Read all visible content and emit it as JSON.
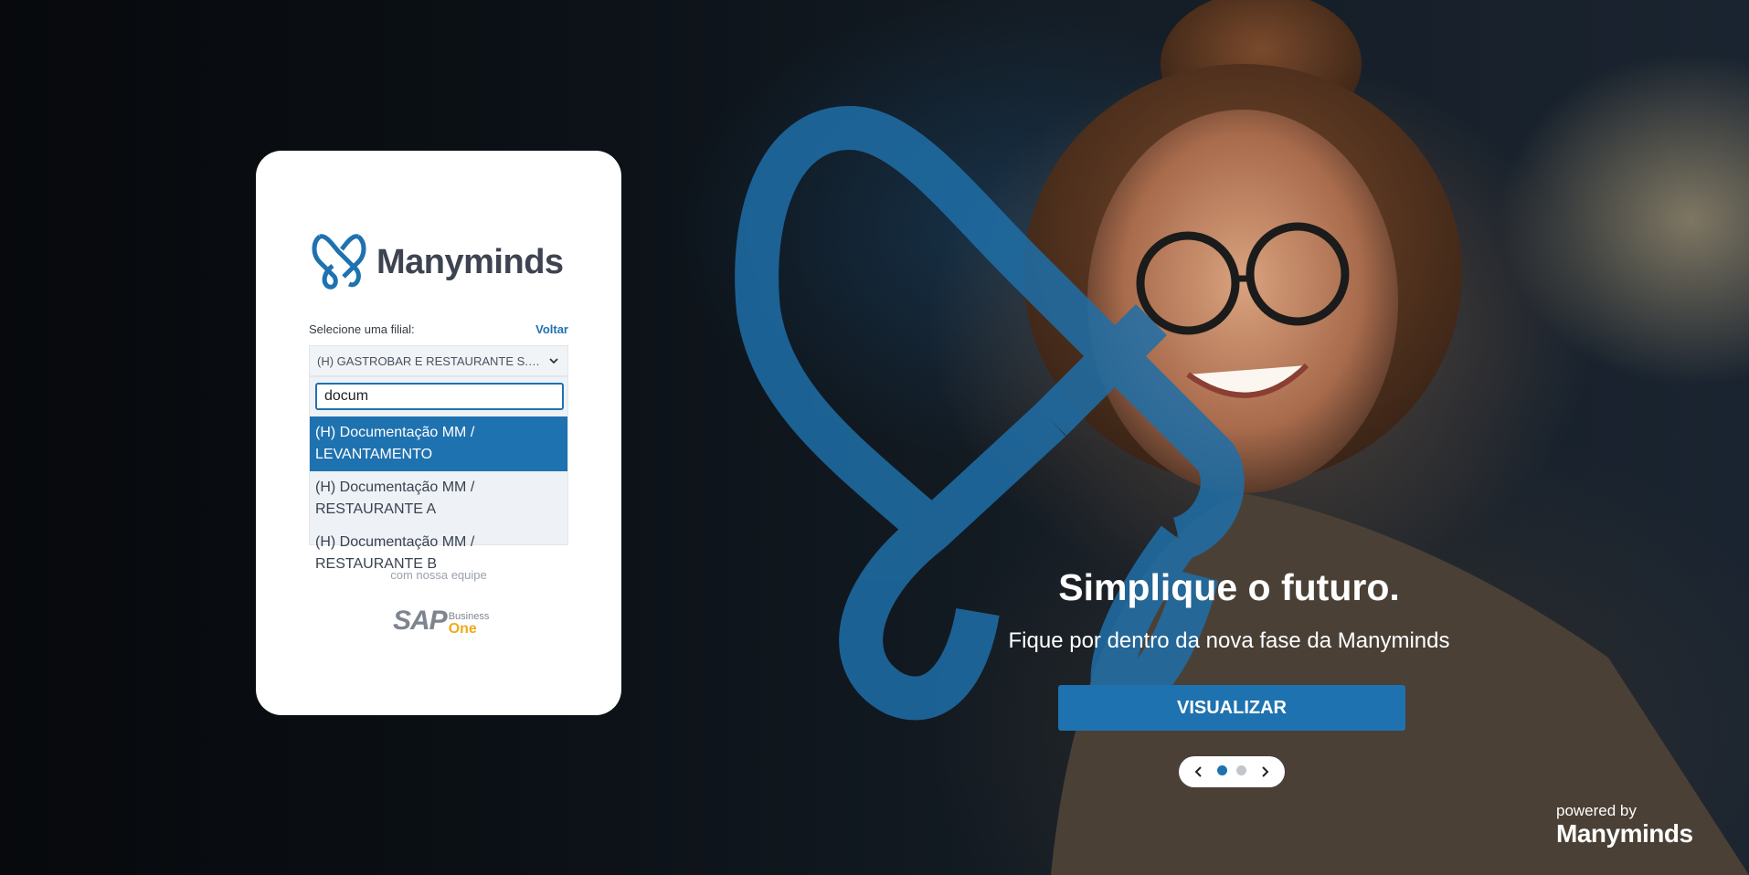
{
  "colors": {
    "accent": "#1f72b0",
    "card": "#ffffff",
    "sap_yellow": "#f0a91c"
  },
  "login_card": {
    "brand_name": "Manyminds",
    "branch_label": "Selecione uma filial:",
    "back_link": "Voltar",
    "selected_branch": "(H) GASTROBAR E RESTAURANTE S.A. ...",
    "search_value": "docum",
    "options": [
      {
        "label": "(H) Documentação MM / LEVANTAMENTO",
        "selected": true
      },
      {
        "label": "(H) Documentação MM / RESTAURANTE A",
        "selected": false
      },
      {
        "label": "(H) Documentação MM / RESTAURANTE B",
        "selected": false
      }
    ],
    "footnote": "com nossa equipe",
    "sap_logo": {
      "word": "SAP",
      "business": "Business",
      "one": "One"
    }
  },
  "hero": {
    "title": "Simplique o futuro.",
    "subtitle": "Fique por dentro da nova fase da Manyminds",
    "cta_label": "VISUALIZAR",
    "carousel": {
      "current": 1,
      "total": 2
    }
  },
  "powered": {
    "by": "powered by",
    "name": "Manyminds"
  },
  "icons": [
    "manyminds-logo-icon",
    "chevron-down-icon",
    "chevron-left-icon",
    "chevron-right-icon"
  ]
}
